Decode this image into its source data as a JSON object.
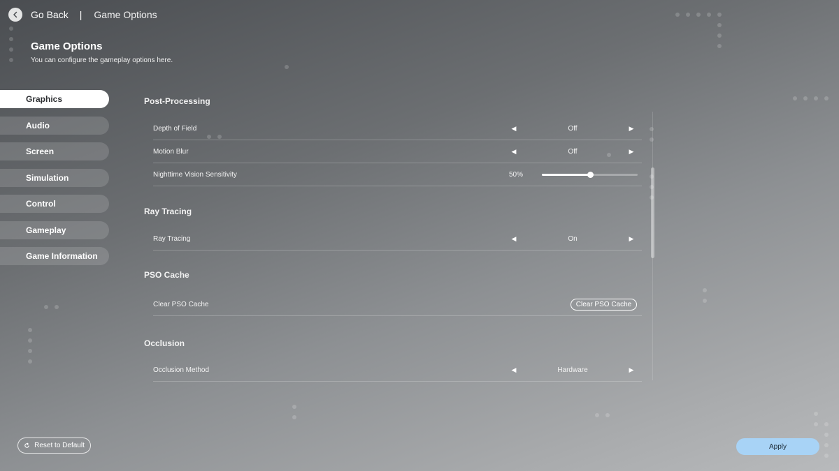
{
  "header": {
    "back_label": "Go Back",
    "separator": "|",
    "breadcrumb": "Game Options",
    "title": "Game Options",
    "subtitle": "You can configure the gameplay options here."
  },
  "sidebar": {
    "items": [
      {
        "label": "Graphics",
        "active": true
      },
      {
        "label": "Audio"
      },
      {
        "label": "Screen"
      },
      {
        "label": "Simulation"
      },
      {
        "label": "Control"
      },
      {
        "label": "Gameplay"
      },
      {
        "label": "Game Information"
      }
    ]
  },
  "sections": {
    "post_processing": {
      "title": "Post-Processing",
      "depth_of_field": {
        "label": "Depth of Field",
        "value": "Off"
      },
      "motion_blur": {
        "label": "Motion Blur",
        "value": "Off"
      },
      "night_vision": {
        "label": "Nighttime Vision Sensitivity",
        "value_text": "50%",
        "value": 0.5
      }
    },
    "ray_tracing": {
      "title": "Ray Tracing",
      "ray_tracing": {
        "label": "Ray Tracing",
        "value": "On"
      }
    },
    "pso_cache": {
      "title": "PSO Cache",
      "clear": {
        "label": "Clear PSO Cache",
        "button": "Clear PSO Cache"
      }
    },
    "occlusion": {
      "title": "Occlusion",
      "method": {
        "label": "Occlusion Method",
        "value": "Hardware"
      }
    }
  },
  "arrows": {
    "left": "◀",
    "right": "▶"
  },
  "footer": {
    "reset_label": "Reset to Default",
    "apply_label": "Apply"
  },
  "colors": {
    "accent_apply": "#a8d3f6",
    "active_tab": "#ffffff"
  }
}
